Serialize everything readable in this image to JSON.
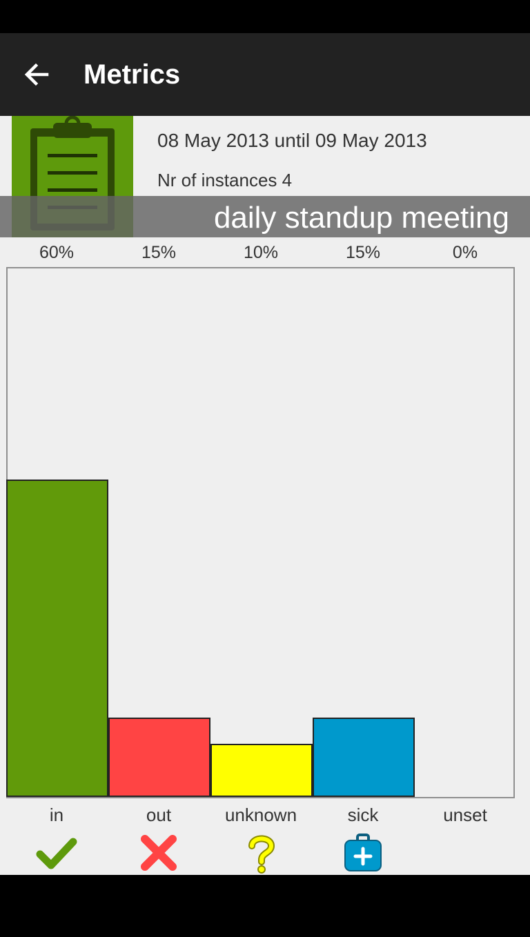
{
  "app_bar": {
    "title": "Metrics",
    "back_icon": "arrow-left-icon"
  },
  "header": {
    "icon": "clipboard-icon",
    "date_range": "08 May 2013 until 09 May 2013",
    "instances": "Nr of instances 4",
    "meeting_name": "daily standup meeting"
  },
  "chart_data": {
    "type": "bar",
    "categories": [
      "in",
      "out",
      "unknown",
      "sick",
      "unset"
    ],
    "values": [
      60,
      15,
      10,
      15,
      0
    ],
    "value_labels": [
      "60%",
      "15%",
      "10%",
      "15%",
      "0%"
    ],
    "unit": "%",
    "colors": [
      "#619a0a",
      "#ff4444",
      "#ffff00",
      "#0099cc",
      "#efefef"
    ],
    "icons": [
      "check-icon",
      "cross-icon",
      "question-icon",
      "medical-bag-icon",
      ""
    ],
    "ylim": [
      0,
      100
    ],
    "grid": false
  }
}
